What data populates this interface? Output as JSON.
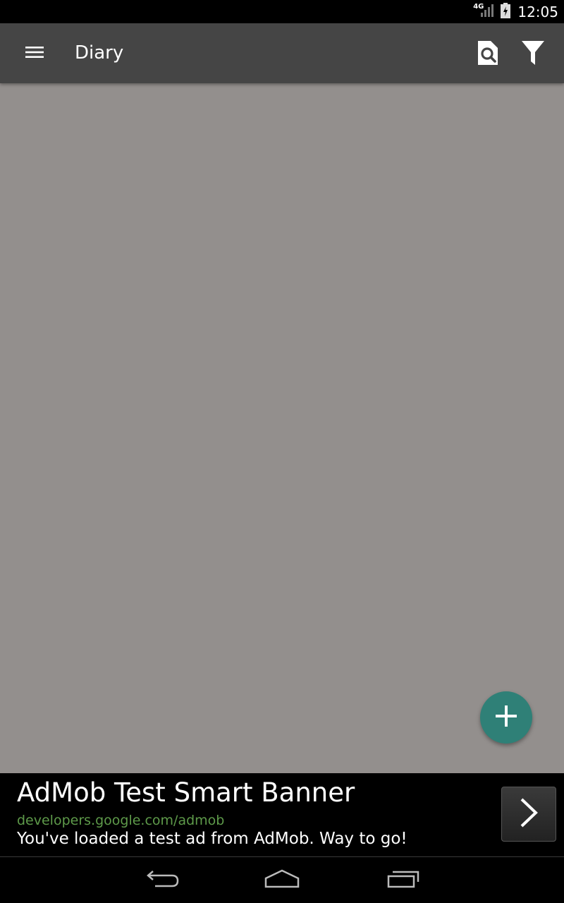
{
  "status_bar": {
    "network": "4G",
    "time": "12:05"
  },
  "app_bar": {
    "title": "Diary",
    "icons": {
      "menu": "menu-icon",
      "search": "search-document-icon",
      "filter": "filter-icon"
    },
    "background": "#454545"
  },
  "content": {
    "background": "#938f8d"
  },
  "fab": {
    "icon": "plus-icon",
    "color": "#2f8077"
  },
  "ad": {
    "title": "AdMob Test Smart Banner",
    "url": "developers.google.com/admob",
    "description": "You've loaded a test ad from AdMob. Way to go!",
    "url_color": "#5e9a4a",
    "arrow_icon": "chevron-right-icon"
  },
  "nav_bar": {
    "icons": [
      "back-icon",
      "home-icon",
      "recents-icon"
    ]
  }
}
